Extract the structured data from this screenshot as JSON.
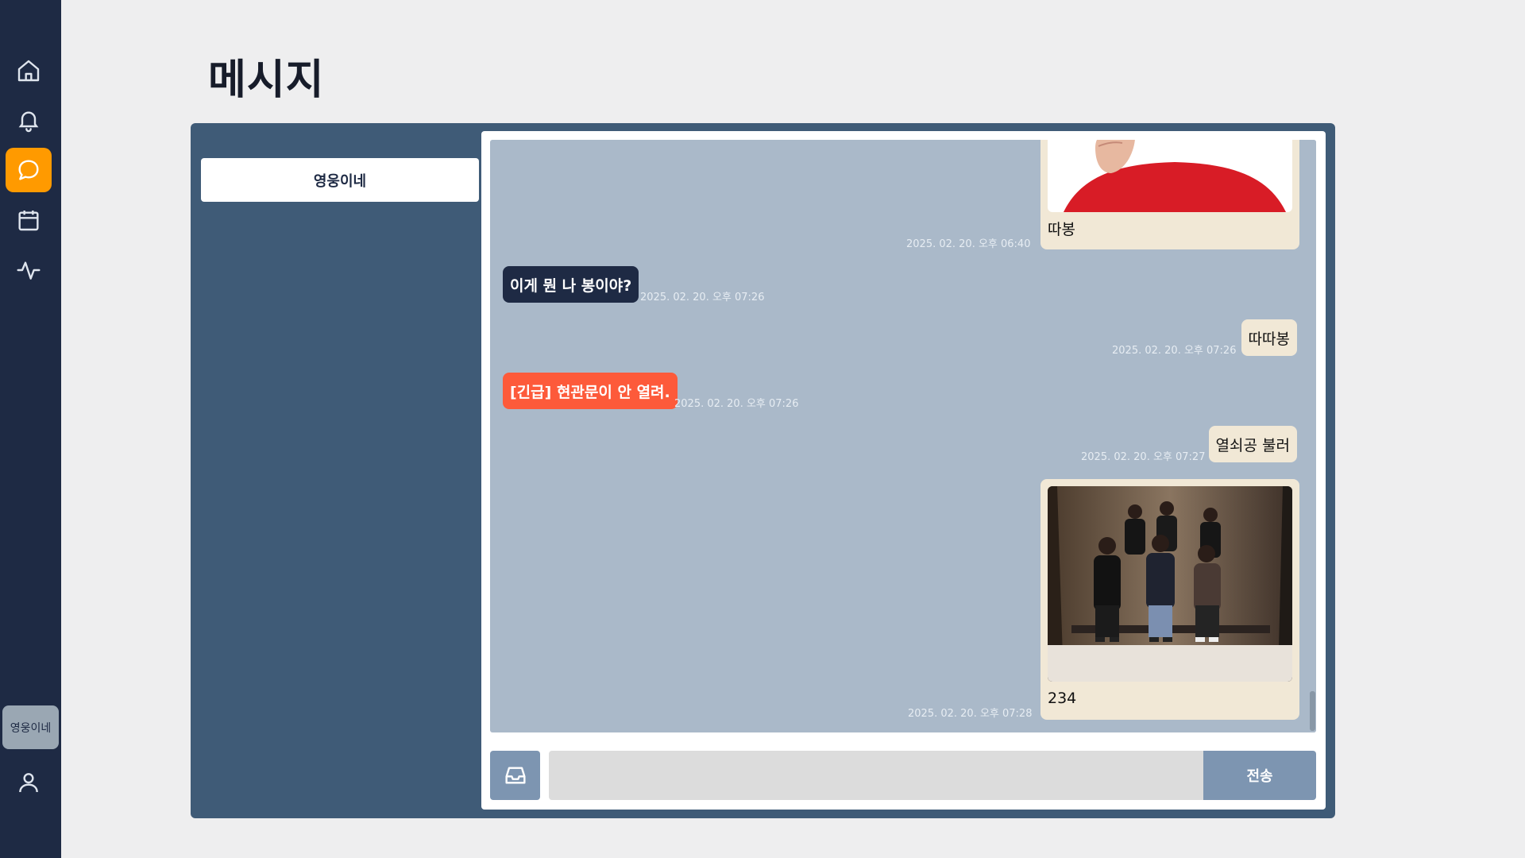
{
  "nav": {
    "items": [
      {
        "icon": "home-icon"
      },
      {
        "icon": "bell-icon"
      },
      {
        "icon": "chat-icon",
        "active": true
      },
      {
        "icon": "calendar-icon"
      },
      {
        "icon": "activity-icon"
      }
    ],
    "group_label": "영웅이네",
    "profile_icon": "user-icon"
  },
  "page": {
    "title": "메시지"
  },
  "rooms": [
    {
      "name": "영웅이네"
    }
  ],
  "messages": [
    {
      "side": "me",
      "type": "image",
      "caption": "따봉",
      "time": "2025. 02. 20. 오후 06:40",
      "image_desc": "person-red-shirt-thumbs-up"
    },
    {
      "side": "other",
      "type": "text",
      "text": "이게 뭔 나 봉이야?",
      "time": "2025. 02. 20. 오후 07:26"
    },
    {
      "side": "me",
      "type": "text",
      "text": "따따봉",
      "time": "2025. 02. 20. 오후 07:26"
    },
    {
      "side": "other",
      "type": "urgent",
      "text": "[긴급] 현관문이 안 열려.",
      "time": "2025. 02. 20. 오후 07:26"
    },
    {
      "side": "me",
      "type": "text",
      "text": "열쇠공 불러",
      "time": "2025. 02. 20. 오후 07:27"
    },
    {
      "side": "me",
      "type": "image",
      "caption": "234",
      "time": "2025. 02. 20. 오후 07:28",
      "image_desc": "group-photo"
    }
  ],
  "composer": {
    "value": "",
    "send_label": "전송",
    "attach_icon": "inbox-icon"
  },
  "colors": {
    "rail": "#1e2a44",
    "active": "#ff9a00",
    "panel": "#3f5b77",
    "chat_bg": "#aab9c9",
    "my_bubble": "#f1e8d6",
    "other_bubble": "#1e2a44",
    "urgent_bubble": "#fd5a3a",
    "button": "#7d95b1"
  }
}
